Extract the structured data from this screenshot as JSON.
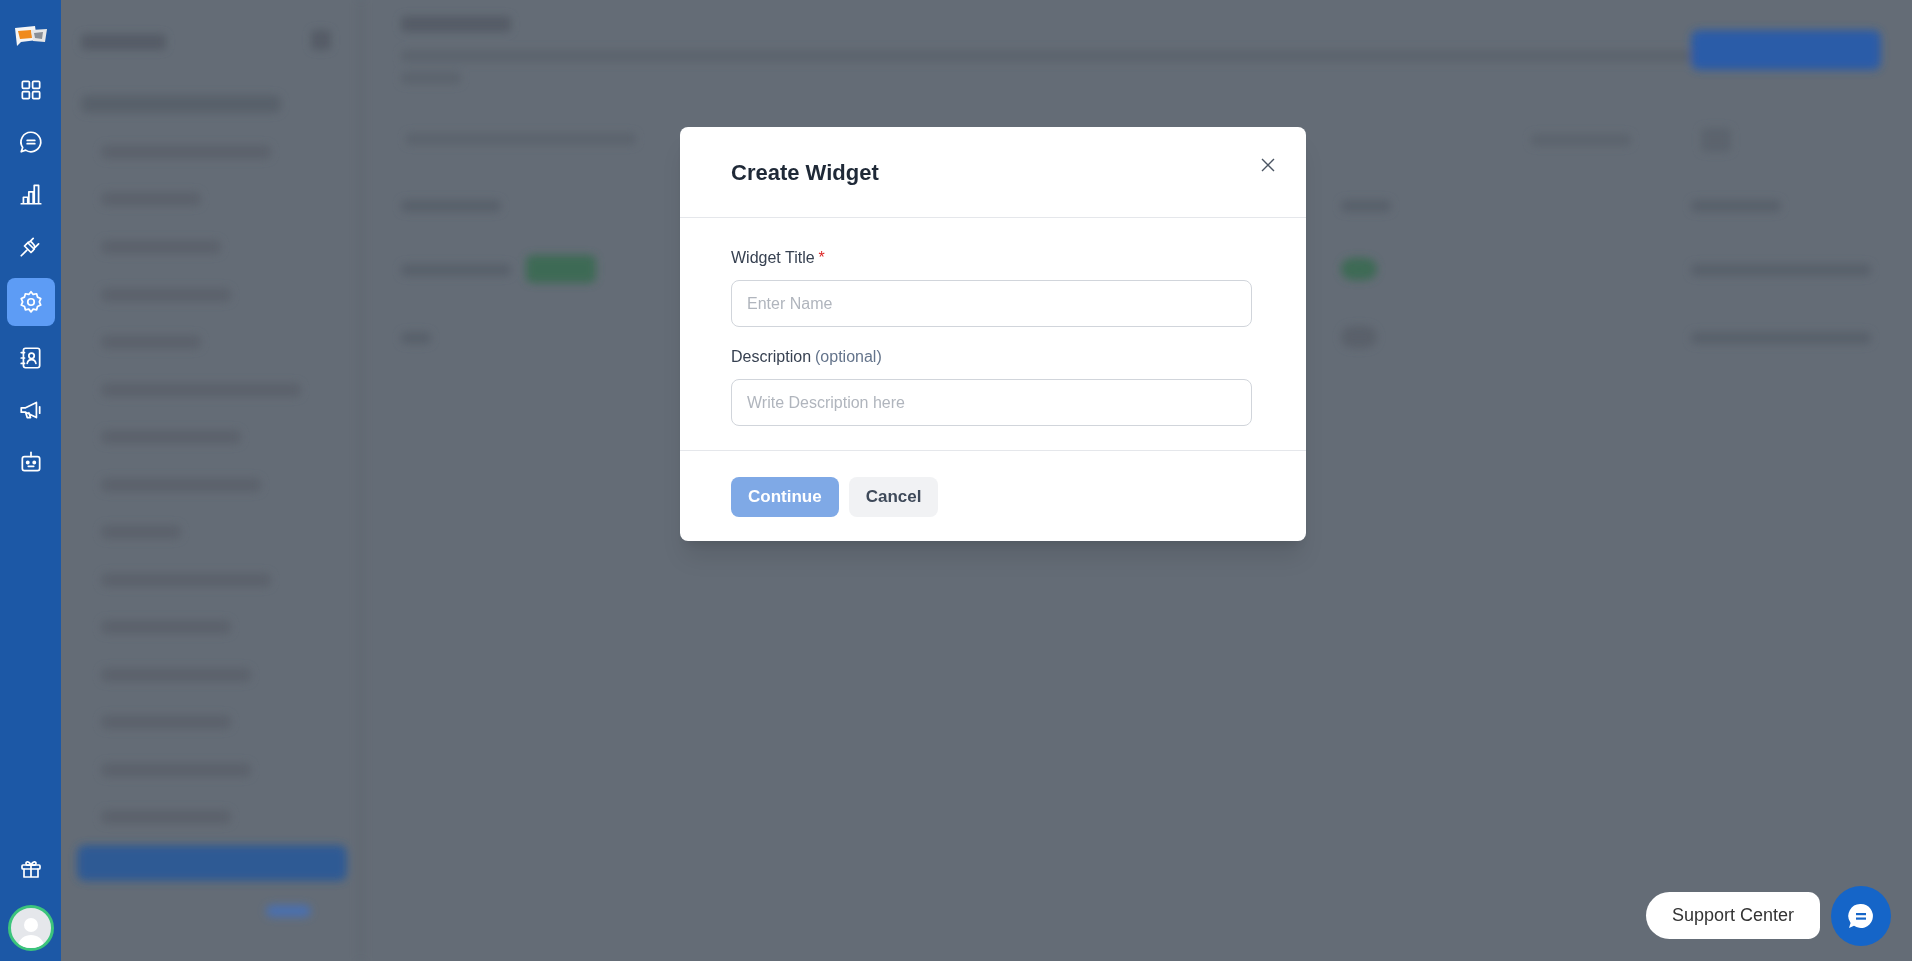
{
  "rail": {
    "items": [
      {
        "selected": false
      },
      {
        "selected": false
      },
      {
        "selected": false
      },
      {
        "selected": false
      },
      {
        "selected": true
      },
      {
        "selected": false
      },
      {
        "selected": false
      },
      {
        "selected": false
      }
    ]
  },
  "dialog": {
    "title": "Create Widget",
    "fields": [
      {
        "label": "Widget Title",
        "required_mark": "*",
        "placeholder": "Enter Name"
      },
      {
        "label": "Description",
        "note": "(optional)",
        "placeholder": "Write Description here"
      }
    ],
    "buttons": [
      {
        "kind": "primary",
        "label": "Continue",
        "disabled": true
      },
      {
        "kind": "secondary",
        "label": "Cancel",
        "disabled": false
      }
    ]
  },
  "support": {
    "label": "Support Center"
  }
}
